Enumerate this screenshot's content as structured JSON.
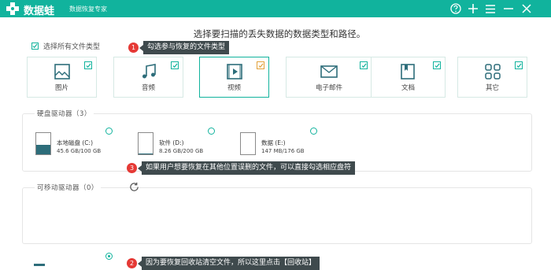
{
  "titlebar": {
    "app_name": "数据蛙",
    "subtitle": "数据恢复专家",
    "icons": [
      "help-icon",
      "add-icon",
      "menu-icon",
      "minimize-icon",
      "close-icon"
    ],
    "bg_color": "#11b39d"
  },
  "heading": "选择要扫描的丢失数据的数据类型和路径。",
  "select_all_label": "选择所有文件类型",
  "file_types": [
    {
      "label": "图片",
      "icon": "image-icon",
      "checked": true
    },
    {
      "label": "音频",
      "icon": "audio-icon",
      "checked": true
    },
    {
      "label": "视频",
      "icon": "video-icon",
      "checked": true
    },
    {
      "label": "电子邮件",
      "icon": "email-icon",
      "checked": true
    },
    {
      "label": "文档",
      "icon": "document-icon",
      "checked": true
    },
    {
      "label": "其它",
      "icon": "other-icon",
      "checked": true
    }
  ],
  "hard_drives": {
    "title": "硬盘驱动器（3）",
    "drives": [
      {
        "name": "本地磁盘 (C:)",
        "size": "45.6 GB/100 GB",
        "used_fraction": 0.456
      },
      {
        "name": "软件 (D:)",
        "size": "8.26 GB/200 GB",
        "used_fraction": 0.04
      },
      {
        "name": "数据 (E:)",
        "size": "147 MB/176 GB",
        "used_fraction": 0.001
      }
    ]
  },
  "removable": {
    "title": "可移动驱动器（0）"
  },
  "tooltips": [
    {
      "num": "1",
      "text": "勾选参与恢复的文件类型"
    },
    {
      "num": "3",
      "text": "如果用户想要恢复在其他位置误删的文件，可以直接勾选相应盘符"
    },
    {
      "num": "2",
      "text": "因为要恢复回收站清空文件，所以这里点击【回收站】"
    }
  ],
  "colors": {
    "accent": "#11b39d",
    "tooltip_bg": "#3f4a4d",
    "badge": "#e53935"
  }
}
